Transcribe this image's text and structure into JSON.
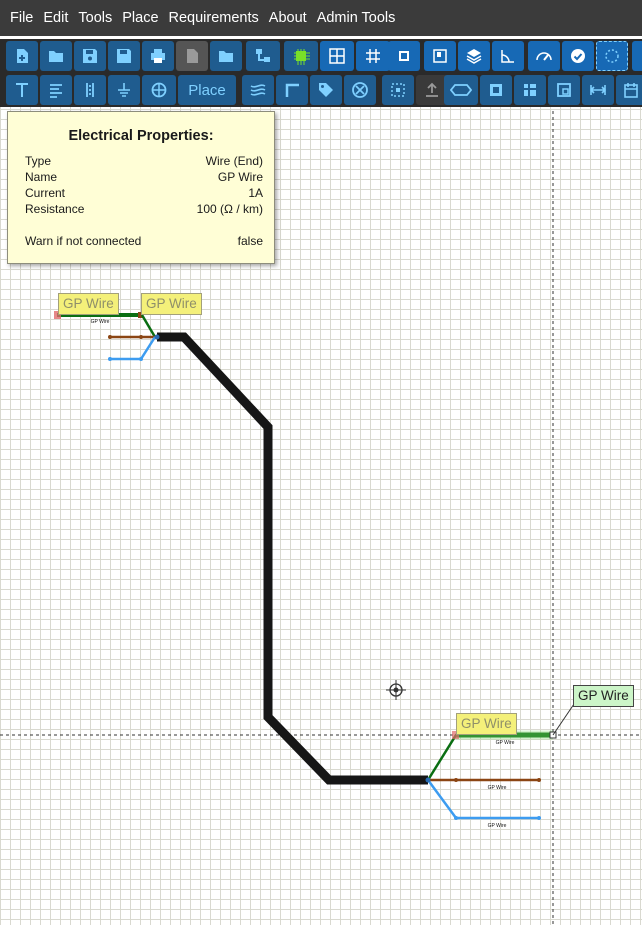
{
  "menu": [
    "File",
    "Edit",
    "Tools",
    "Place",
    "Requirements",
    "About",
    "Admin Tools"
  ],
  "toolbar2": {
    "place_label": "Place"
  },
  "properties": {
    "title": "Electrical Properties:",
    "rows": [
      {
        "key": "Type",
        "value": "Wire (End)"
      },
      {
        "key": "Name",
        "value": "GP Wire"
      },
      {
        "key": "Current",
        "value": "1A"
      },
      {
        "key": "Resistance",
        "value": "100 (Ω / km)"
      },
      {
        "key": "Warn if not connected",
        "value": "false"
      }
    ]
  },
  "labels": {
    "top_left": "GP Wire",
    "top_right": "GP Wire",
    "bottom_mid": "GP Wire",
    "bottom_right": "GP Wire",
    "small": "GP Wire"
  },
  "colors": {
    "menubar": "#3b3b3b",
    "toolbar_button": "#1f5c8f",
    "icon": "#7fd0ff",
    "wire_black": "#161616",
    "wire_green": "#0a6e12",
    "wire_brown": "#8b4513",
    "wire_blue": "#3d9cf0",
    "label_yellow": "#f4f07a",
    "label_green": "#ccf5c8"
  }
}
